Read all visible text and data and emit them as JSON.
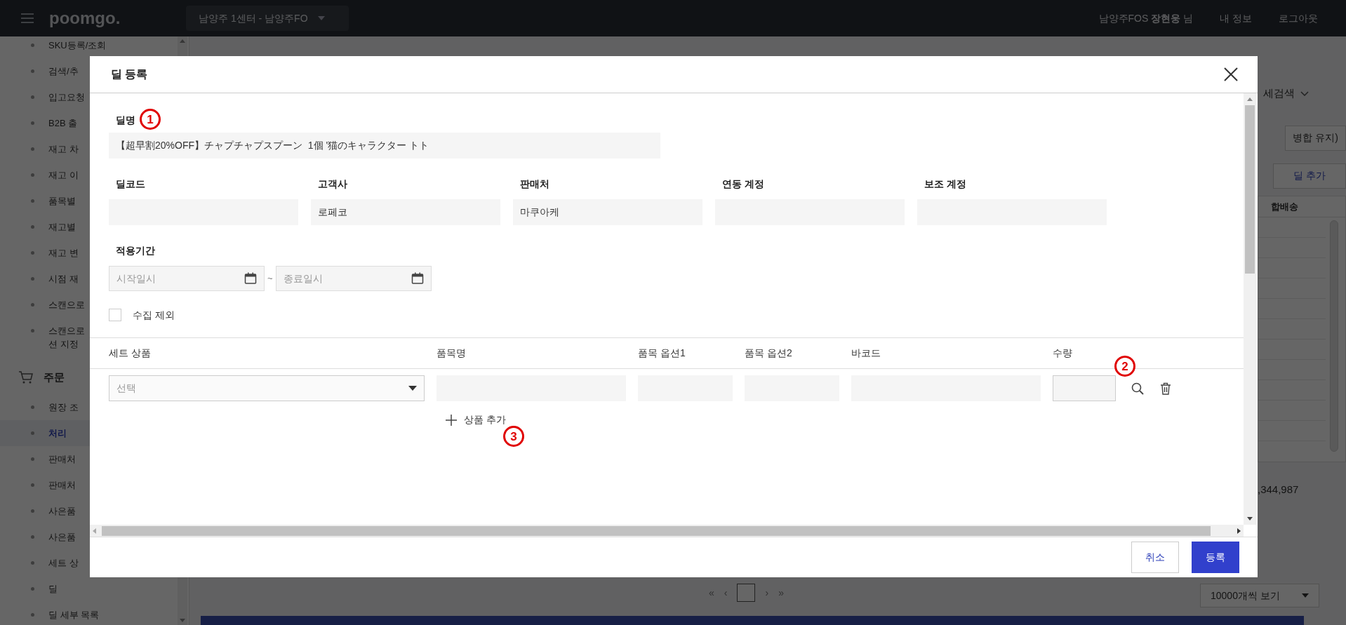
{
  "header": {
    "logo": "poomgo.",
    "center": "남양주 1센터 - 남양주FO",
    "user_prefix": "남양주FOS ",
    "user_name": "장현웅",
    "user_suffix": " 님",
    "links": [
      "내 정보",
      "로그아웃"
    ]
  },
  "sidebar": {
    "items_top": [
      {
        "label": "SKU등록/조회",
        "selected": false
      },
      {
        "label": "검색/추",
        "selected": false
      },
      {
        "label": "입고요청",
        "selected": false
      },
      {
        "label": "B2B 출",
        "selected": false
      },
      {
        "label": "재고 차",
        "selected": false
      },
      {
        "label": "재고 이",
        "selected": false
      },
      {
        "label": "품목별",
        "selected": false
      },
      {
        "label": "재고별",
        "selected": false
      },
      {
        "label": "재고 변",
        "selected": false
      },
      {
        "label": "시점 재",
        "selected": false
      },
      {
        "label": "스캔으로",
        "selected": false
      },
      {
        "label": "스캔으로",
        "label2": "션 지정",
        "selected": false
      }
    ],
    "section": "주문",
    "items": [
      {
        "label": "원장 조",
        "selected": false
      },
      {
        "label": "처리",
        "selected": true
      },
      {
        "label": "판매처",
        "selected": false
      },
      {
        "label": "판매처",
        "selected": false
      },
      {
        "label": "사은품",
        "selected": false
      },
      {
        "label": "사은품",
        "selected": false
      },
      {
        "label": "세트 상",
        "selected": false
      },
      {
        "label": "딜",
        "selected": false
      },
      {
        "label": "딜 세부 목록",
        "selected": false
      }
    ]
  },
  "background": {
    "search_toggle": "세검색",
    "merge_button": "병합 유지)",
    "add_button": "딜 추가",
    "column": "합배송",
    "total": ",344,987",
    "pagination": [
      "«",
      "‹",
      "›",
      "»"
    ],
    "page_size": "10000개씩 보기"
  },
  "modal": {
    "title": "딜 등록",
    "name": {
      "label": "딜명",
      "value": "【超早割20%OFF】チャプチャプスプーン  1個 '猫のキャラクター トト"
    },
    "fields": [
      {
        "label": "딜코드"
      },
      {
        "label": "고객사",
        "value": "로페코"
      },
      {
        "label": "판매처",
        "value": "마쿠아케"
      },
      {
        "label": "연동 계정"
      },
      {
        "label": "보조 계정"
      }
    ],
    "period": {
      "label": "적용기간",
      "start_placeholder": "시작일시",
      "separator": "~",
      "end_placeholder": "종료일시"
    },
    "exclude": {
      "label": "수집 제외",
      "checked": false
    },
    "table": {
      "columns": [
        "세트 상품",
        "품목명",
        "품목 옵션1",
        "품목 옵션2",
        "바코드",
        "수량"
      ],
      "rows": [
        {
          "set_placeholder": "선택"
        }
      ]
    },
    "add_item": "상품 추가",
    "buttons": [
      "취소",
      "등록"
    ]
  },
  "annotations": [
    "1",
    "2",
    "3"
  ]
}
